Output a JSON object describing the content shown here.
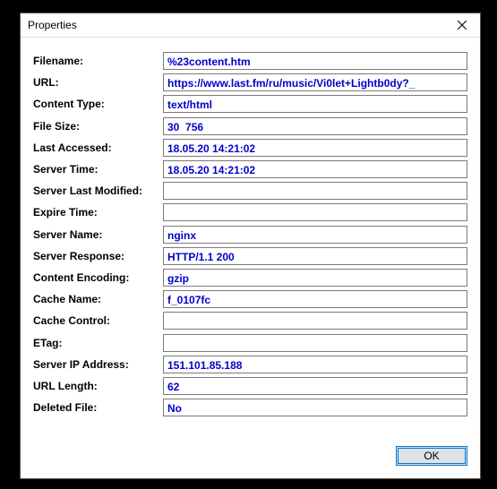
{
  "window": {
    "title": "Properties",
    "ok_label": "OK"
  },
  "fields": [
    {
      "label": "Filename:",
      "value": "%23content.htm"
    },
    {
      "label": "URL:",
      "value": "https://www.last.fm/ru/music/Vi0let+Lightb0dy?_"
    },
    {
      "label": "Content Type:",
      "value": "text/html"
    },
    {
      "label": "File Size:",
      "value": "30  756"
    },
    {
      "label": "Last Accessed:",
      "value": "18.05.20 14:21:02"
    },
    {
      "label": "Server Time:",
      "value": "18.05.20 14:21:02"
    },
    {
      "label": "Server Last Modified:",
      "value": ""
    },
    {
      "label": "Expire Time:",
      "value": ""
    },
    {
      "label": "Server Name:",
      "value": "nginx"
    },
    {
      "label": "Server Response:",
      "value": "HTTP/1.1 200"
    },
    {
      "label": "Content Encoding:",
      "value": "gzip"
    },
    {
      "label": "Cache Name:",
      "value": "f_0107fc"
    },
    {
      "label": "Cache Control:",
      "value": ""
    },
    {
      "label": "ETag:",
      "value": ""
    },
    {
      "label": "Server IP Address:",
      "value": "151.101.85.188"
    },
    {
      "label": "URL Length:",
      "value": "62"
    },
    {
      "label": "Deleted File:",
      "value": "No"
    }
  ]
}
